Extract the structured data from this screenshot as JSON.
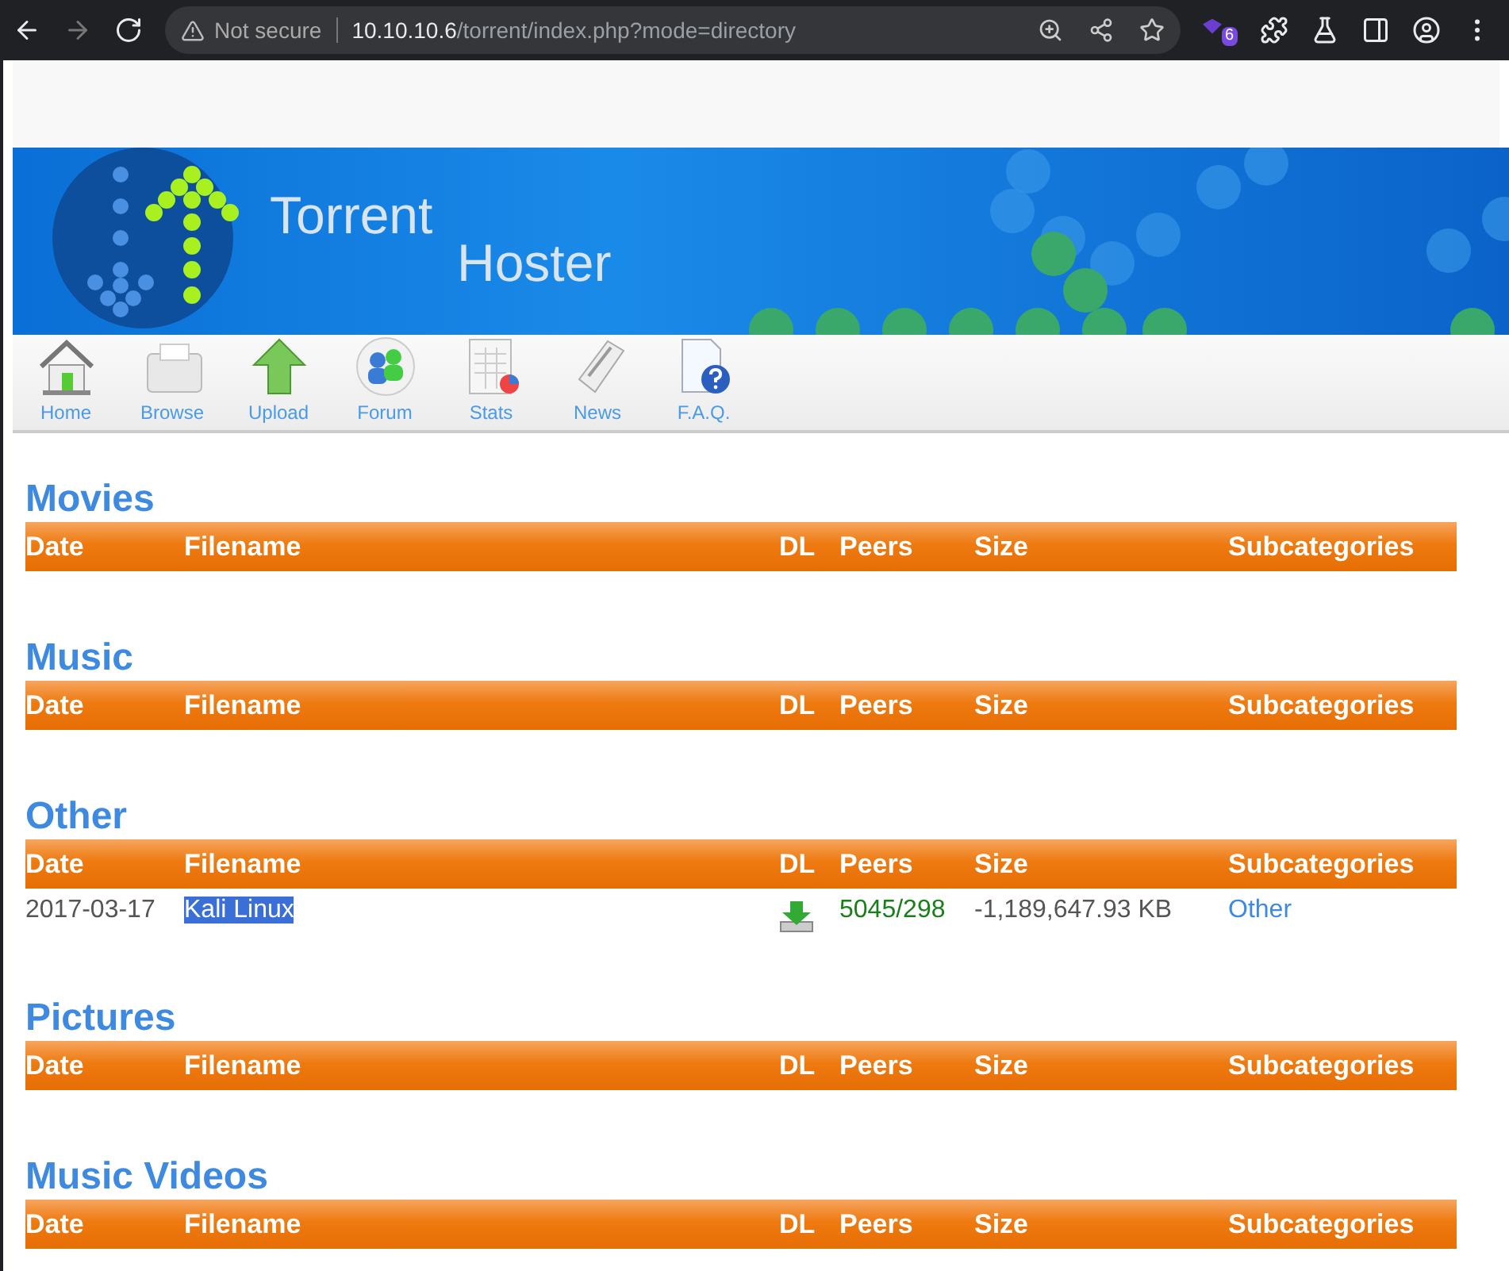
{
  "browser": {
    "security": "Not secure",
    "url_host": "10.10.10.6",
    "url_path": "/torrent/index.php?mode=directory",
    "extension_badge": "6"
  },
  "banner": {
    "title_line_1": "Torrent",
    "title_line_2": "Hoster"
  },
  "nav": [
    {
      "label": "Home",
      "kind": "home"
    },
    {
      "label": "Browse",
      "kind": "browse"
    },
    {
      "label": "Upload",
      "kind": "upload"
    },
    {
      "label": "Forum",
      "kind": "forum"
    },
    {
      "label": "Stats",
      "kind": "stats"
    },
    {
      "label": "News",
      "kind": "news"
    },
    {
      "label": "F.A.Q.",
      "kind": "faq"
    }
  ],
  "sections": [
    {
      "title": "Movies",
      "columns": [
        "Date",
        "Filename",
        "DL",
        "Peers",
        "Size",
        "Subcategories"
      ]
    },
    {
      "title": "Music",
      "columns": [
        "Date",
        "Filename",
        "DL",
        "Peers",
        "Size",
        "Subcategories"
      ]
    },
    {
      "title": "Other",
      "columns": [
        "Date",
        "Filename",
        "DL",
        "Peers",
        "Size",
        "Subcategories"
      ],
      "rows": [
        {
          "date": "2017-03-17",
          "filename": "Kali Linux",
          "filename_highlighted": true,
          "peers": "5045/298",
          "size": "-1,189,647.93 KB",
          "subcategory": "Other"
        }
      ]
    },
    {
      "title": "Pictures",
      "columns": [
        "Date",
        "Filename",
        "DL",
        "Peers",
        "Size",
        "Subcategories"
      ]
    },
    {
      "title": "Music Videos",
      "columns": [
        "Date",
        "Filename",
        "DL",
        "Peers",
        "Size",
        "Subcategories"
      ]
    }
  ]
}
